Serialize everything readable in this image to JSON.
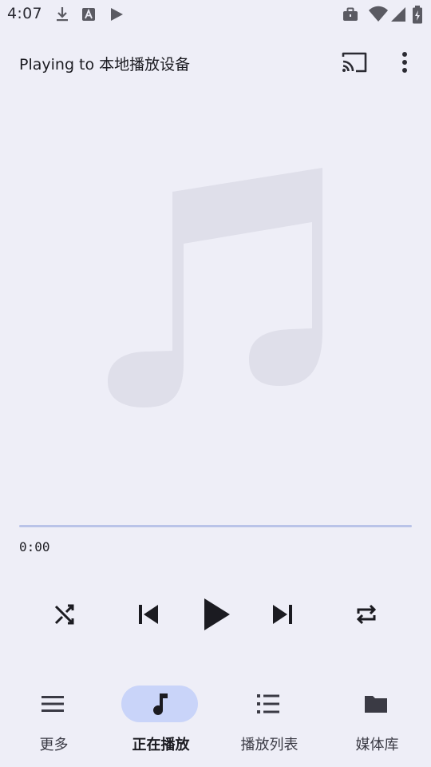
{
  "status_bar": {
    "time": "4:07",
    "icons": [
      "download-icon",
      "translate-icon",
      "play-store-icon",
      "briefcase-icon",
      "wifi-icon",
      "signal-icon",
      "battery-icon"
    ]
  },
  "app_bar": {
    "title": "Playing to 本地播放设备",
    "actions": [
      "cast-icon",
      "more-vert-icon"
    ]
  },
  "player": {
    "artwork_icon": "music-note-icon",
    "progress_fraction": 0.0,
    "current_time": "0:00",
    "controls": [
      "shuffle-icon",
      "skip-previous-icon",
      "play-icon",
      "skip-next-icon",
      "repeat-icon"
    ]
  },
  "bottom_nav": {
    "items": [
      {
        "label": "更多",
        "icon": "menu-icon",
        "active": false
      },
      {
        "label": "正在播放",
        "icon": "music-note-icon",
        "active": true
      },
      {
        "label": "播放列表",
        "icon": "list-icon",
        "active": false
      },
      {
        "label": "媒体库",
        "icon": "folder-icon",
        "active": false
      }
    ]
  },
  "colors": {
    "background": "#eeeef7",
    "active_pill": "#c9d4f9",
    "progress_track": "#b9c3e8",
    "icon": "#1b1b21",
    "artwork": "#dfdfea"
  }
}
